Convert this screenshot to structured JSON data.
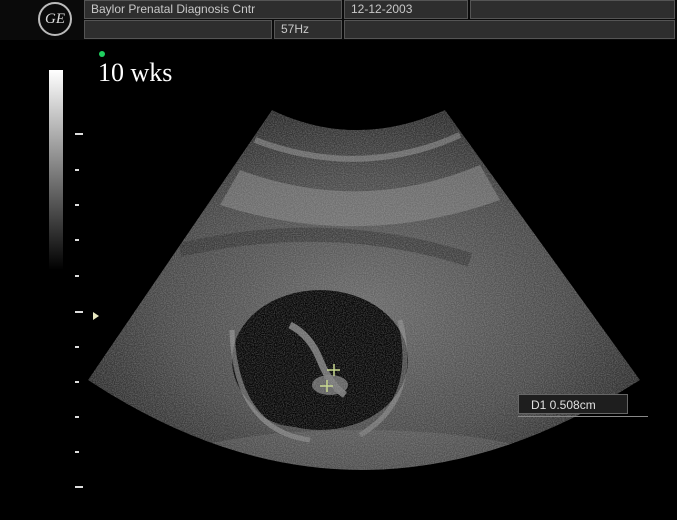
{
  "header": {
    "institution": "Baylor Prenatal Diagnosis Cntr",
    "date": "12-12-2003",
    "frame_rate": "57Hz"
  },
  "image": {
    "gestational_age_label": "10 wks",
    "measurement_label": "D1  0.508cm"
  },
  "colors": {
    "background": "#000000",
    "indicator": "#1fd060",
    "caliper": "#c8d890"
  },
  "icons": {
    "logo": "ge-logo"
  }
}
